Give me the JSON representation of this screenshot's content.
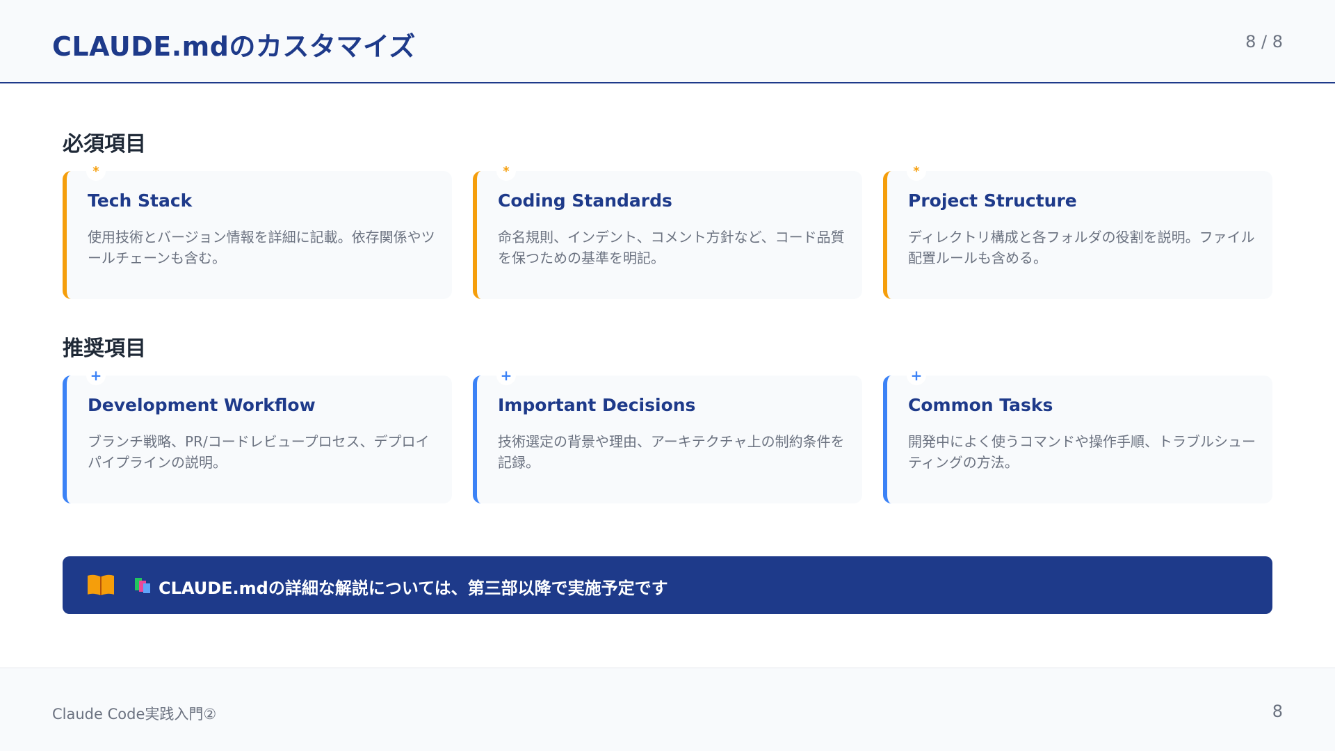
{
  "header": {
    "title": "CLAUDE.mdのカスタマイズ",
    "page_count": "8 / 8"
  },
  "required_section": {
    "title": "必須項目",
    "marker": "*",
    "cards": [
      {
        "title": "Tech Stack",
        "desc": "使用技術とバージョン情報を詳細に記載。依存関係やツールチェーンも含む。"
      },
      {
        "title": "Coding Standards",
        "desc": "命名規則、インデント、コメント方針など、コード品質を保つための基準を明記。"
      },
      {
        "title": "Project Structure",
        "desc": "ディレクトリ構成と各フォルダの役割を説明。ファイル配置ルールも含める。"
      }
    ]
  },
  "recommended_section": {
    "title": "推奨項目",
    "marker": "+",
    "cards": [
      {
        "title": "Development Workflow",
        "desc": "ブランチ戦略、PR/コードレビュープロセス、デプロイパイプラインの説明。"
      },
      {
        "title": "Important Decisions",
        "desc": "技術選定の背景や理由、アーキテクチャ上の制約条件を記録。"
      },
      {
        "title": "Common Tasks",
        "desc": "開発中によく使うコマンドや操作手順、トラブルシューティングの方法。"
      }
    ]
  },
  "banner": {
    "text": "CLAUDE.mdの詳細な解説については、第三部以降で実施予定です",
    "icons": [
      "open-book-icon",
      "books-icon"
    ]
  },
  "footer": {
    "left": "Claude Code実践入門②",
    "right": "8"
  },
  "colors": {
    "primary": "#1e3a8a",
    "required_accent": "#f59e0b",
    "recommended_accent": "#3b82f6",
    "card_bg": "#f8fafc"
  }
}
